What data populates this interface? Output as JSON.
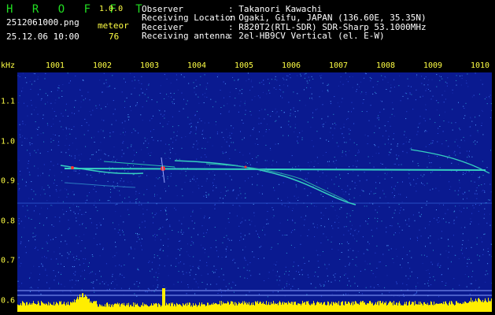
{
  "app": {
    "name": "H R O F F T",
    "version": "1.0.0"
  },
  "file": {
    "name": "2512061000.png",
    "datetime": "25.12.06 10:00"
  },
  "meteor": {
    "label": "meteor",
    "count": "76"
  },
  "station": [
    {
      "label": "Observer",
      "value": ": Takanori Kawachi"
    },
    {
      "label": "Receiving Location",
      "value": ": Ogaki, Gifu, JAPAN (136.60E, 35.35N)"
    },
    {
      "label": "Receiver",
      "value": ": R820T2(RTL-SDR) SDR-Sharp 53.1000MHz"
    },
    {
      "label": "Receiving antenna",
      "value": ": 2el-HB9CV Vertical (el. E-W)"
    }
  ],
  "axes": {
    "y_unit": "kHz",
    "x_ticks": [
      "1001",
      "1002",
      "1003",
      "1004",
      "1005",
      "1006",
      "1007",
      "1008",
      "1009",
      "1010"
    ],
    "y_ticks": [
      "1.1",
      "1.0",
      "0.9",
      "0.8",
      "0.7",
      "0.6"
    ]
  },
  "colors": {
    "background": "#000000",
    "spectrum": "#0a1a90",
    "brand": "#22dd22",
    "accent": "#ffff44",
    "text": "#ffffff",
    "echo": "#36d0c0",
    "hot": "#ff3030",
    "noise_floor": "#ffee00"
  }
}
